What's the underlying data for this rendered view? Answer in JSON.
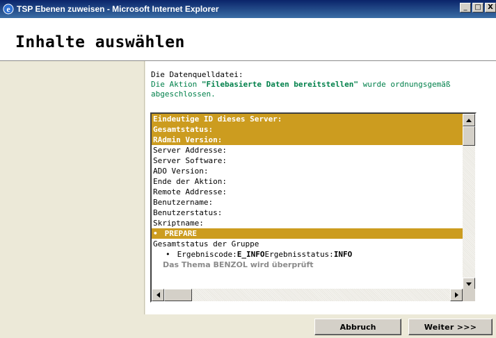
{
  "window": {
    "title": "TSP Ebenen zuweisen - Microsoft Internet Explorer",
    "minimize": "_",
    "maximize": "□",
    "close": "X",
    "colors": {
      "title_gradient_start": "#0a246a",
      "title_gradient_end": "#3a6ea5"
    }
  },
  "header": {
    "title": "Inhalte auswählen"
  },
  "intro": {
    "line1": "Die Datenquelldatei:",
    "line2_prefix": "Die Aktion ",
    "line2_action": "\"Filebasierte Daten bereitstellen\"",
    "line2_suffix": " wurde ordnungsgemäß",
    "line3": "abgeschlossen."
  },
  "listbox": {
    "highlight_color": "#cc9c1f",
    "rows": [
      {
        "text": "Eindeutige ID dieses Server:",
        "style": "hl"
      },
      {
        "text": "Gesamtstatus:",
        "style": "hl"
      },
      {
        "text": "RAdmin Version:",
        "style": "hl"
      },
      {
        "text": "Server Addresse:",
        "style": "normal"
      },
      {
        "text": "Server Software:",
        "style": "normal"
      },
      {
        "text": "ADO Version:",
        "style": "normal"
      },
      {
        "text": "Ende der Aktion:",
        "style": "normal"
      },
      {
        "text": "Remote Addresse:",
        "style": "normal"
      },
      {
        "text": "Benutzername:",
        "style": "normal"
      },
      {
        "text": "Benutzerstatus:",
        "style": "normal"
      },
      {
        "text": "Skriptname:",
        "style": "normal"
      },
      {
        "text": "PREPARE",
        "style": "hl-bullet"
      },
      {
        "text": "Gesamtstatus der Gruppe",
        "style": "normal"
      }
    ],
    "result_row": {
      "label1": "Ergebniscode:",
      "value1": "E_INFO",
      "label2": "Ergebnisstatus:",
      "value2": "INFO"
    },
    "message": "Das Thema BENZOL wird überprüft"
  },
  "buttons": {
    "cancel": "Abbruch",
    "next": "Weiter >>>"
  }
}
